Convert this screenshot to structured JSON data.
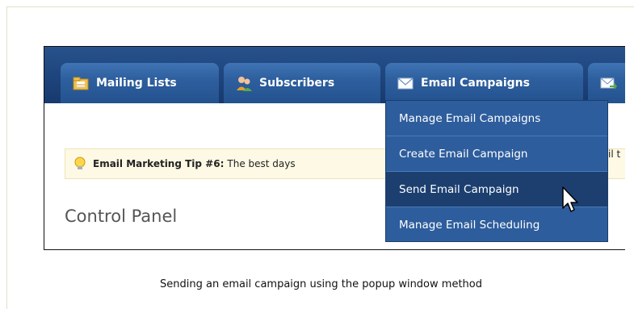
{
  "tabs": [
    {
      "label": "Mailing Lists",
      "icon": "folder-icon"
    },
    {
      "label": "Subscribers",
      "icon": "users-icon"
    },
    {
      "label": "Email Campaigns",
      "icon": "envelope-icon"
    },
    {
      "label": "",
      "icon": "envelope-forward-icon"
    }
  ],
  "dropdown": {
    "items": [
      {
        "label": "Manage Email Campaigns",
        "active": false
      },
      {
        "label": "Create Email Campaign",
        "active": false
      },
      {
        "label": "Send Email Campaign",
        "active": true
      },
      {
        "label": "Manage Email Scheduling",
        "active": false
      }
    ]
  },
  "tip": {
    "prefix": "Email Marketing Tip #6:",
    "text": "The best days",
    "tail": "il t"
  },
  "control_panel": "Control Panel",
  "caption": "Sending an email campaign using the popup window method",
  "colors": {
    "navbar": "#1d447c",
    "tab": "#2e5f9e",
    "dropdown": "#2d5d9c",
    "dropdown_active": "#1c3f70",
    "tip_bg": "#fdf9e4"
  }
}
